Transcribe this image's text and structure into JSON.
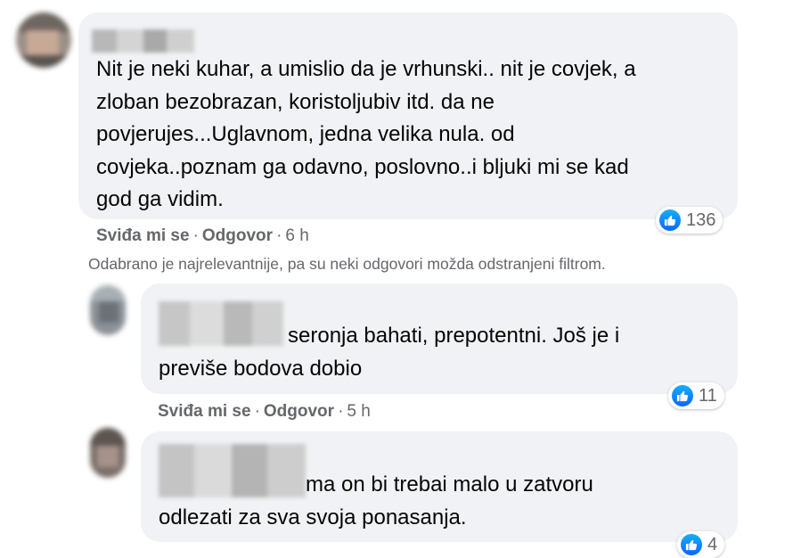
{
  "comments": [
    {
      "text_lines": [
        "Nit je neki kuhar, a umislio da je vrhunski.. nit je covjek, a",
        "zloban bezobrazan, koristoljubiv itd. da ne",
        "povjerujes...Uglavnom, jedna velika nula. od",
        "covjeka..poznam ga odavno, poslovno..i bljuki mi se kad",
        "god ga vidim."
      ],
      "reaction_count": "136",
      "like_label": "Sviđa mi se",
      "reply_label": "Odgovor",
      "separator": "·",
      "time": "6 h"
    }
  ],
  "filter_notice": "Odabrano je najrelevantnije, pa su neki odgovori možda odstranjeni filtrom.",
  "replies": [
    {
      "text_lines": [
        "seronja bahati, prepotentni. Još je i",
        "previše bodova dobio"
      ],
      "reaction_count": "11",
      "like_label": "Sviđa mi se",
      "reply_label": "Odgovor",
      "separator": "·",
      "time": "5 h"
    },
    {
      "text_lines": [
        "ma on bi trebai malo u zatvoru",
        "odlezati za sva svoja ponasanja."
      ],
      "reaction_count": "4"
    }
  ],
  "colors": {
    "bubble": "#f0f2f5",
    "secondary_text": "#65676b",
    "like_blue": "#0866ff"
  },
  "icons": {
    "reaction": "like-thumb-icon"
  }
}
